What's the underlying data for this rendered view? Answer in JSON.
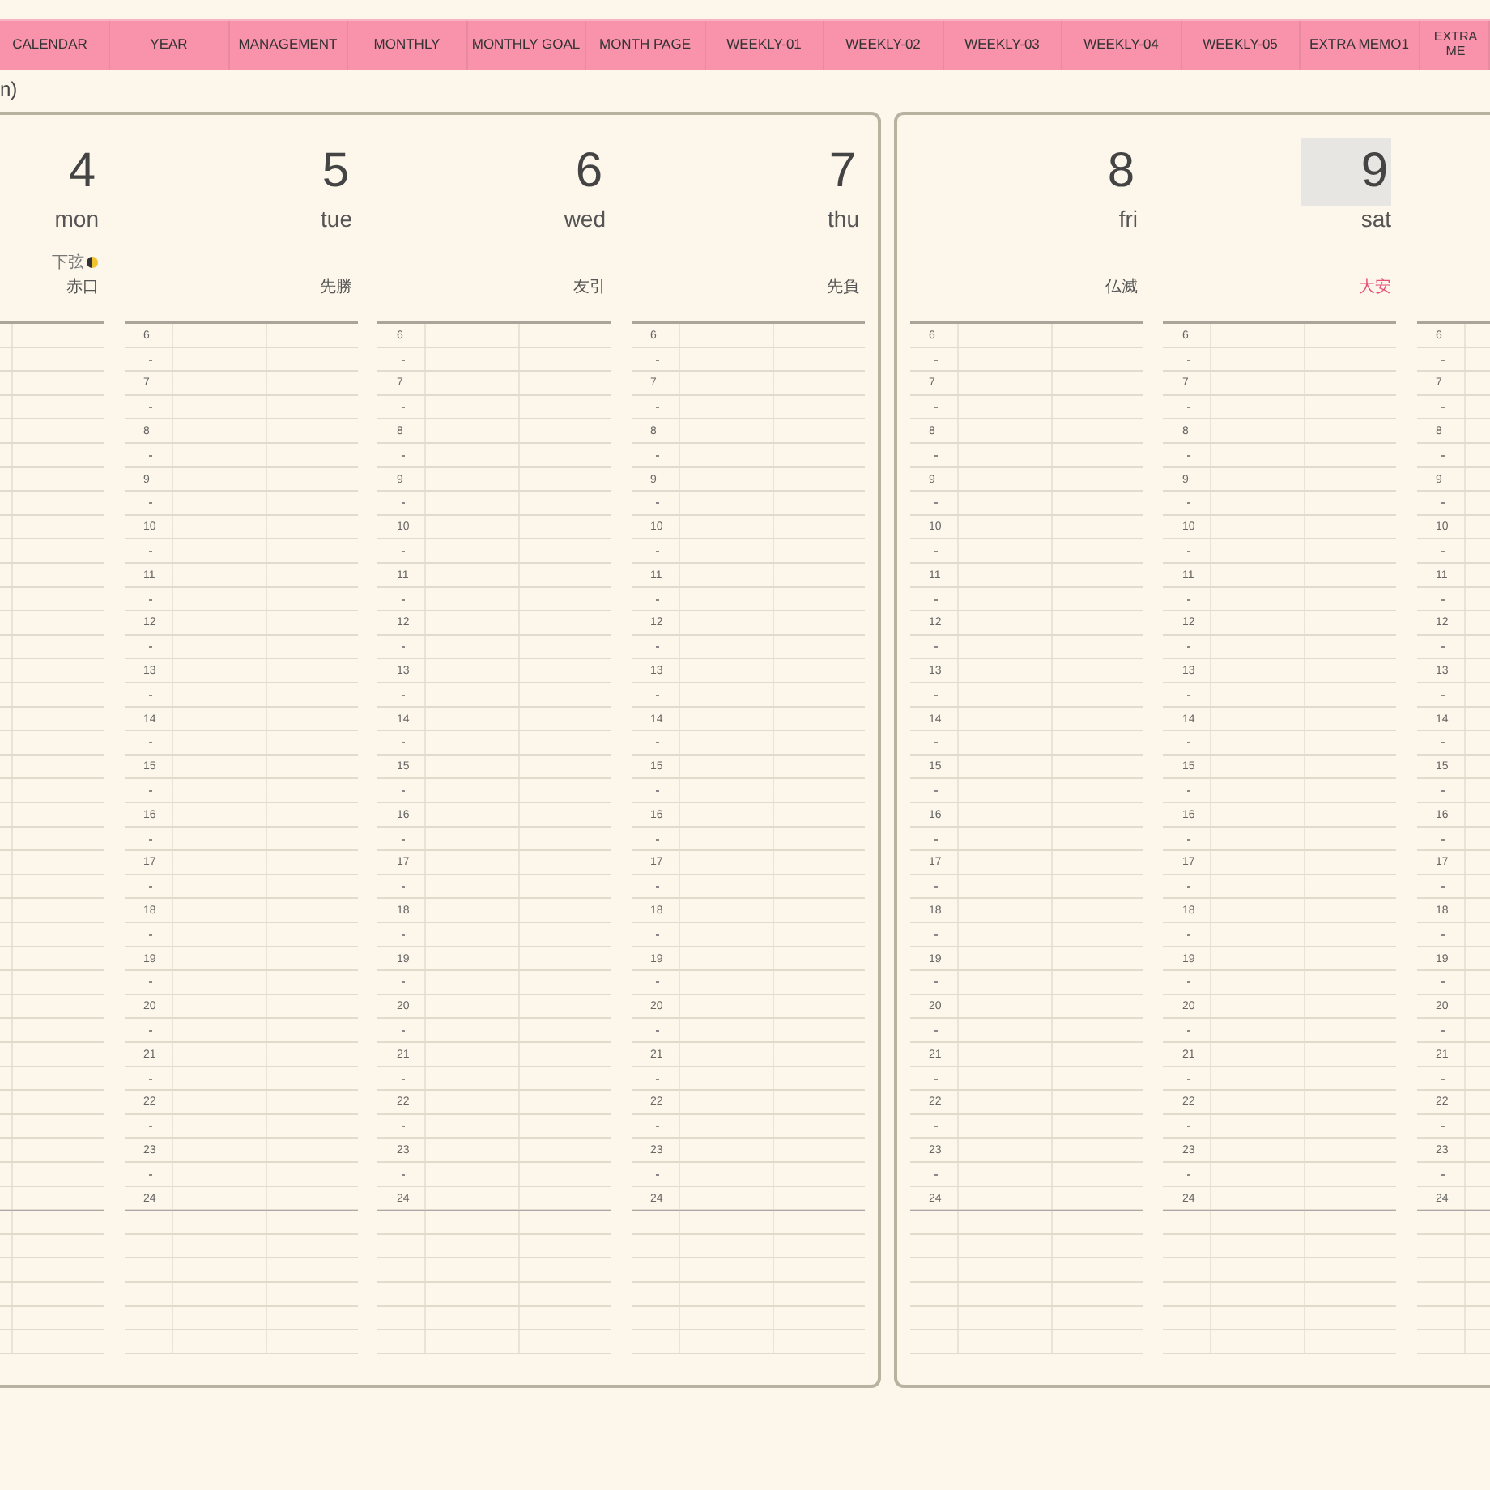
{
  "nav": {
    "tabs": [
      {
        "label": "CALENDAR"
      },
      {
        "label": "YEAR"
      },
      {
        "label": "MANAGEMENT"
      },
      {
        "label": "MONTHLY"
      },
      {
        "label": "MONTHLY GOAL"
      },
      {
        "label": "MONTH PAGE"
      },
      {
        "label": "WEEKLY-01"
      },
      {
        "label": "WEEKLY-02"
      },
      {
        "label": "WEEKLY-03"
      },
      {
        "label": "WEEKLY-04"
      },
      {
        "label": "WEEKLY-05"
      },
      {
        "label": "EXTRA MEMO1"
      },
      {
        "label": "EXTRA ME"
      }
    ]
  },
  "breadcrumb": "n)",
  "pages": [
    {
      "columns": [
        {
          "date": "4",
          "weekday": "mon",
          "selected": false,
          "moon": {
            "label": "下弦"
          },
          "rokuyo": {
            "text": "赤口",
            "color": "#555555"
          }
        },
        {
          "date": "5",
          "weekday": "tue",
          "selected": false,
          "rokuyo": {
            "text": "先勝",
            "color": "#555555"
          },
          "hours": [
            "6",
            "7",
            "8",
            "9",
            "10",
            "11",
            "12",
            "13",
            "14",
            "15",
            "16",
            "17",
            "18",
            "19",
            "20",
            "21",
            "22",
            "23",
            "24"
          ]
        },
        {
          "date": "6",
          "weekday": "wed",
          "selected": false,
          "rokuyo": {
            "text": "友引",
            "color": "#555555"
          },
          "hours": [
            "6",
            "7",
            "8",
            "9",
            "10",
            "11",
            "12",
            "13",
            "14",
            "15",
            "16",
            "17",
            "18",
            "19",
            "20",
            "21",
            "22",
            "23",
            "24"
          ]
        },
        {
          "date": "7",
          "weekday": "thu",
          "selected": false,
          "rokuyo": {
            "text": "先負",
            "color": "#555555"
          },
          "hours": [
            "6",
            "7",
            "8",
            "9",
            "10",
            "11",
            "12",
            "13",
            "14",
            "15",
            "16",
            "17",
            "18",
            "19",
            "20",
            "21",
            "22",
            "23",
            "24"
          ]
        }
      ]
    },
    {
      "columns": [
        {
          "date": "8",
          "weekday": "fri",
          "selected": false,
          "rokuyo": {
            "text": "仏滅",
            "color": "#555555"
          },
          "hours": [
            "6",
            "7",
            "8",
            "9",
            "10",
            "11",
            "12",
            "13",
            "14",
            "15",
            "16",
            "17",
            "18",
            "19",
            "20",
            "21",
            "22",
            "23",
            "24"
          ]
        },
        {
          "date": "9",
          "weekday": "sat",
          "selected": true,
          "rokuyo": {
            "text": "大安",
            "color": "#e8507a"
          },
          "hours": [
            "6",
            "7",
            "8",
            "9",
            "10",
            "11",
            "12",
            "13",
            "14",
            "15",
            "16",
            "17",
            "18",
            "19",
            "20",
            "21",
            "22",
            "23",
            "24"
          ]
        },
        {
          "hours": [
            "6",
            "7",
            "8",
            "9",
            "10",
            "11",
            "12",
            "13",
            "14",
            "15",
            "16",
            "17",
            "18",
            "19",
            "20",
            "21",
            "22",
            "23",
            "24"
          ]
        }
      ]
    }
  ]
}
